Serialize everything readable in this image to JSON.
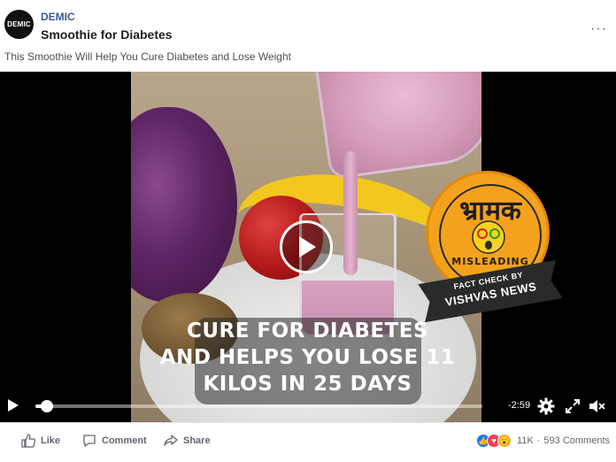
{
  "post": {
    "avatar_text": "DEMIC",
    "page_name": "DEMIC",
    "title": "Smoothie for Diabetes",
    "more_label": "···",
    "text": "This Smoothie Will Help You Cure Diabetes and Lose Weight"
  },
  "video": {
    "caption_lines": [
      "CURE FOR DIABETES",
      "AND HELPS YOU LOSE 11",
      "KILOS IN 25 DAYS"
    ],
    "badge": {
      "hindi": "भ्रामक",
      "label": "MISLEADING",
      "ribbon_top": "FACT CHECK BY",
      "ribbon_bottom": "VISHVAS NEWS",
      "color": "#f4a21e"
    },
    "time_remaining": "-2:59",
    "progress": 0.015,
    "icons": [
      "play-icon",
      "settings-gear-icon",
      "fullscreen-icon",
      "volume-muted-icon"
    ]
  },
  "actions": {
    "like": "Like",
    "comment": "Comment",
    "share": "Share"
  },
  "reactions": {
    "types": [
      "like",
      "love",
      "wow"
    ],
    "count": "11K",
    "separator": "·",
    "comments": "593 Comments"
  },
  "colors": {
    "link": "#385898",
    "action_text": "#606770",
    "like_blue": "#1877f2"
  }
}
